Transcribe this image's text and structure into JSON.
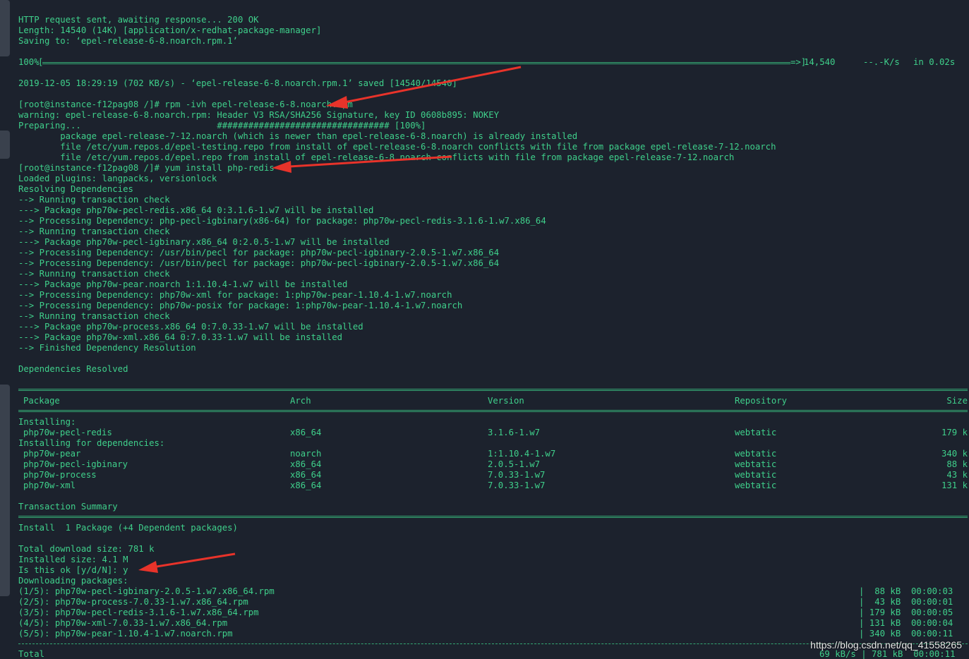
{
  "terminal": {
    "pre_lines": [
      "HTTP request sent, awaiting response... 200 OK",
      "Length: 14540 (14K) [application/x-redhat-package-manager]",
      "Saving to: ‘epel-release-6-8.noarch.rpm.1’"
    ],
    "progress": {
      "percent": "100%",
      "bytes": "14,540",
      "rate": "--.-K/s",
      "time": "in 0.02s",
      "fill_fraction": 1.0
    },
    "saved_line": "2019-12-05 18:29:19 (702 KB/s) - ‘epel-release-6-8.noarch.rpm.1’ saved [14540/14540]",
    "rpm_block": [
      "[root@instance-f12pag08 /]# rpm -ivh epel-release-6-8.noarch.rpm",
      "warning: epel-release-6-8.noarch.rpm: Header V3 RSA/SHA256 Signature, key ID 0608b895: NOKEY",
      "Preparing...                          ################################# [100%]",
      "        package epel-release-7-12.noarch (which is newer than epel-release-6-8.noarch) is already installed",
      "        file /etc/yum.repos.d/epel-testing.repo from install of epel-release-6-8.noarch conflicts with file from package epel-release-7-12.noarch",
      "        file /etc/yum.repos.d/epel.repo from install of epel-release-6-8.noarch conflicts with file from package epel-release-7-12.noarch",
      "[root@instance-f12pag08 /]# yum install php-redis",
      "Loaded plugins: langpacks, versionlock",
      "Resolving Dependencies",
      "--> Running transaction check",
      "---> Package php70w-pecl-redis.x86_64 0:3.1.6-1.w7 will be installed",
      "--> Processing Dependency: php-pecl-igbinary(x86-64) for package: php70w-pecl-redis-3.1.6-1.w7.x86_64",
      "--> Running transaction check",
      "---> Package php70w-pecl-igbinary.x86_64 0:2.0.5-1.w7 will be installed",
      "--> Processing Dependency: /usr/bin/pecl for package: php70w-pecl-igbinary-2.0.5-1.w7.x86_64",
      "--> Processing Dependency: /usr/bin/pecl for package: php70w-pecl-igbinary-2.0.5-1.w7.x86_64",
      "--> Running transaction check",
      "---> Package php70w-pear.noarch 1:1.10.4-1.w7 will be installed",
      "--> Processing Dependency: php70w-xml for package: 1:php70w-pear-1.10.4-1.w7.noarch",
      "--> Processing Dependency: php70w-posix for package: 1:php70w-pear-1.10.4-1.w7.noarch",
      "--> Running transaction check",
      "---> Package php70w-process.x86_64 0:7.0.33-1.w7 will be installed",
      "---> Package php70w-xml.x86_64 0:7.0.33-1.w7 will be installed",
      "--> Finished Dependency Resolution"
    ],
    "deps_resolved": "Dependencies Resolved",
    "table": {
      "headers": {
        "package": "Package",
        "arch": "Arch",
        "version": "Version",
        "repository": "Repository",
        "size": "Size"
      },
      "installing_label": "Installing:",
      "installing": [
        {
          "package": "php70w-pecl-redis",
          "arch": "x86_64",
          "version": "3.1.6-1.w7",
          "repo": "webtatic",
          "size": "179 k"
        }
      ],
      "deps_label": "Installing for dependencies:",
      "deps": [
        {
          "package": "php70w-pear",
          "arch": "noarch",
          "version": "1:1.10.4-1.w7",
          "repo": "webtatic",
          "size": "340 k"
        },
        {
          "package": "php70w-pecl-igbinary",
          "arch": "x86_64",
          "version": "2.0.5-1.w7",
          "repo": "webtatic",
          "size": "88 k"
        },
        {
          "package": "php70w-process",
          "arch": "x86_64",
          "version": "7.0.33-1.w7",
          "repo": "webtatic",
          "size": "43 k"
        },
        {
          "package": "php70w-xml",
          "arch": "x86_64",
          "version": "7.0.33-1.w7",
          "repo": "webtatic",
          "size": "131 k"
        }
      ]
    },
    "summary": {
      "title": "Transaction Summary",
      "install_line": "Install  1 Package (+4 Dependent packages)",
      "total_download": "Total download size: 781 k",
      "installed_size": "Installed size: 4.1 M",
      "prompt": "Is this ok [y/d/N]: y",
      "downloading": "Downloading packages:"
    },
    "downloads": [
      {
        "name": "(1/5): php70w-pecl-igbinary-2.0.5-1.w7.x86_64.rpm",
        "stats": "|  88 kB  00:00:03"
      },
      {
        "name": "(2/5): php70w-process-7.0.33-1.w7.x86_64.rpm",
        "stats": "|  43 kB  00:00:01"
      },
      {
        "name": "(3/5): php70w-pecl-redis-3.1.6-1.w7.x86_64.rpm",
        "stats": "| 179 kB  00:00:05"
      },
      {
        "name": "(4/5): php70w-xml-7.0.33-1.w7.x86_64.rpm",
        "stats": "| 131 kB  00:00:04"
      },
      {
        "name": "(5/5): php70w-pear-1.10.4-1.w7.noarch.rpm",
        "stats": "| 340 kB  00:00:11"
      }
    ],
    "total": {
      "label": "Total",
      "stats": "69 kB/s | 781 kB  00:00:11"
    }
  },
  "watermark": "https://blog.csdn.net/qq_41558265",
  "colors": {
    "background": "#1c222d",
    "text": "#3fd08b",
    "arrow": "#e8332a",
    "watermark": "#e8e8e8"
  }
}
